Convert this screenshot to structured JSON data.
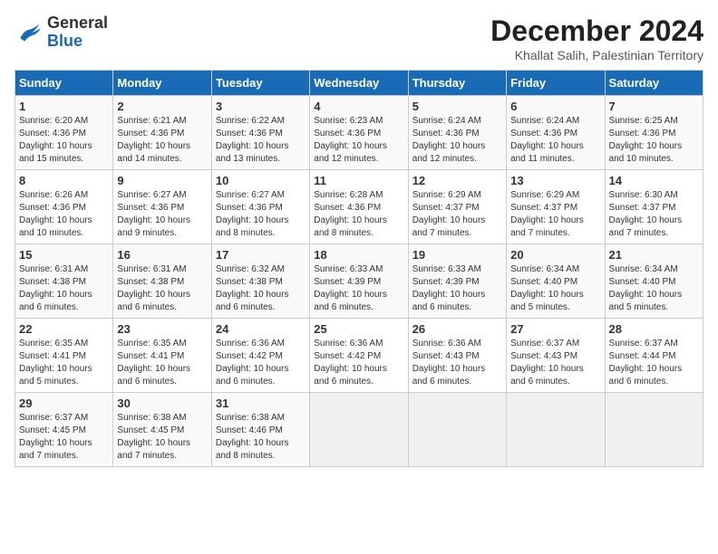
{
  "logo": {
    "general": "General",
    "blue": "Blue"
  },
  "title": "December 2024",
  "location": "Khallat Salih, Palestinian Territory",
  "days_of_week": [
    "Sunday",
    "Monday",
    "Tuesday",
    "Wednesday",
    "Thursday",
    "Friday",
    "Saturday"
  ],
  "weeks": [
    [
      {
        "day": "1",
        "sunrise": "6:20 AM",
        "sunset": "4:36 PM",
        "daylight": "10 hours and 15 minutes."
      },
      {
        "day": "2",
        "sunrise": "6:21 AM",
        "sunset": "4:36 PM",
        "daylight": "10 hours and 14 minutes."
      },
      {
        "day": "3",
        "sunrise": "6:22 AM",
        "sunset": "4:36 PM",
        "daylight": "10 hours and 13 minutes."
      },
      {
        "day": "4",
        "sunrise": "6:23 AM",
        "sunset": "4:36 PM",
        "daylight": "10 hours and 12 minutes."
      },
      {
        "day": "5",
        "sunrise": "6:24 AM",
        "sunset": "4:36 PM",
        "daylight": "10 hours and 12 minutes."
      },
      {
        "day": "6",
        "sunrise": "6:24 AM",
        "sunset": "4:36 PM",
        "daylight": "10 hours and 11 minutes."
      },
      {
        "day": "7",
        "sunrise": "6:25 AM",
        "sunset": "4:36 PM",
        "daylight": "10 hours and 10 minutes."
      }
    ],
    [
      {
        "day": "8",
        "sunrise": "6:26 AM",
        "sunset": "4:36 PM",
        "daylight": "10 hours and 10 minutes."
      },
      {
        "day": "9",
        "sunrise": "6:27 AM",
        "sunset": "4:36 PM",
        "daylight": "10 hours and 9 minutes."
      },
      {
        "day": "10",
        "sunrise": "6:27 AM",
        "sunset": "4:36 PM",
        "daylight": "10 hours and 8 minutes."
      },
      {
        "day": "11",
        "sunrise": "6:28 AM",
        "sunset": "4:36 PM",
        "daylight": "10 hours and 8 minutes."
      },
      {
        "day": "12",
        "sunrise": "6:29 AM",
        "sunset": "4:37 PM",
        "daylight": "10 hours and 7 minutes."
      },
      {
        "day": "13",
        "sunrise": "6:29 AM",
        "sunset": "4:37 PM",
        "daylight": "10 hours and 7 minutes."
      },
      {
        "day": "14",
        "sunrise": "6:30 AM",
        "sunset": "4:37 PM",
        "daylight": "10 hours and 7 minutes."
      }
    ],
    [
      {
        "day": "15",
        "sunrise": "6:31 AM",
        "sunset": "4:38 PM",
        "daylight": "10 hours and 6 minutes."
      },
      {
        "day": "16",
        "sunrise": "6:31 AM",
        "sunset": "4:38 PM",
        "daylight": "10 hours and 6 minutes."
      },
      {
        "day": "17",
        "sunrise": "6:32 AM",
        "sunset": "4:38 PM",
        "daylight": "10 hours and 6 minutes."
      },
      {
        "day": "18",
        "sunrise": "6:33 AM",
        "sunset": "4:39 PM",
        "daylight": "10 hours and 6 minutes."
      },
      {
        "day": "19",
        "sunrise": "6:33 AM",
        "sunset": "4:39 PM",
        "daylight": "10 hours and 6 minutes."
      },
      {
        "day": "20",
        "sunrise": "6:34 AM",
        "sunset": "4:40 PM",
        "daylight": "10 hours and 5 minutes."
      },
      {
        "day": "21",
        "sunrise": "6:34 AM",
        "sunset": "4:40 PM",
        "daylight": "10 hours and 5 minutes."
      }
    ],
    [
      {
        "day": "22",
        "sunrise": "6:35 AM",
        "sunset": "4:41 PM",
        "daylight": "10 hours and 5 minutes."
      },
      {
        "day": "23",
        "sunrise": "6:35 AM",
        "sunset": "4:41 PM",
        "daylight": "10 hours and 6 minutes."
      },
      {
        "day": "24",
        "sunrise": "6:36 AM",
        "sunset": "4:42 PM",
        "daylight": "10 hours and 6 minutes."
      },
      {
        "day": "25",
        "sunrise": "6:36 AM",
        "sunset": "4:42 PM",
        "daylight": "10 hours and 6 minutes."
      },
      {
        "day": "26",
        "sunrise": "6:36 AM",
        "sunset": "4:43 PM",
        "daylight": "10 hours and 6 minutes."
      },
      {
        "day": "27",
        "sunrise": "6:37 AM",
        "sunset": "4:43 PM",
        "daylight": "10 hours and 6 minutes."
      },
      {
        "day": "28",
        "sunrise": "6:37 AM",
        "sunset": "4:44 PM",
        "daylight": "10 hours and 6 minutes."
      }
    ],
    [
      {
        "day": "29",
        "sunrise": "6:37 AM",
        "sunset": "4:45 PM",
        "daylight": "10 hours and 7 minutes."
      },
      {
        "day": "30",
        "sunrise": "6:38 AM",
        "sunset": "4:45 PM",
        "daylight": "10 hours and 7 minutes."
      },
      {
        "day": "31",
        "sunrise": "6:38 AM",
        "sunset": "4:46 PM",
        "daylight": "10 hours and 8 minutes."
      },
      null,
      null,
      null,
      null
    ]
  ],
  "labels": {
    "sunrise": "Sunrise:",
    "sunset": "Sunset:",
    "daylight": "Daylight:"
  }
}
